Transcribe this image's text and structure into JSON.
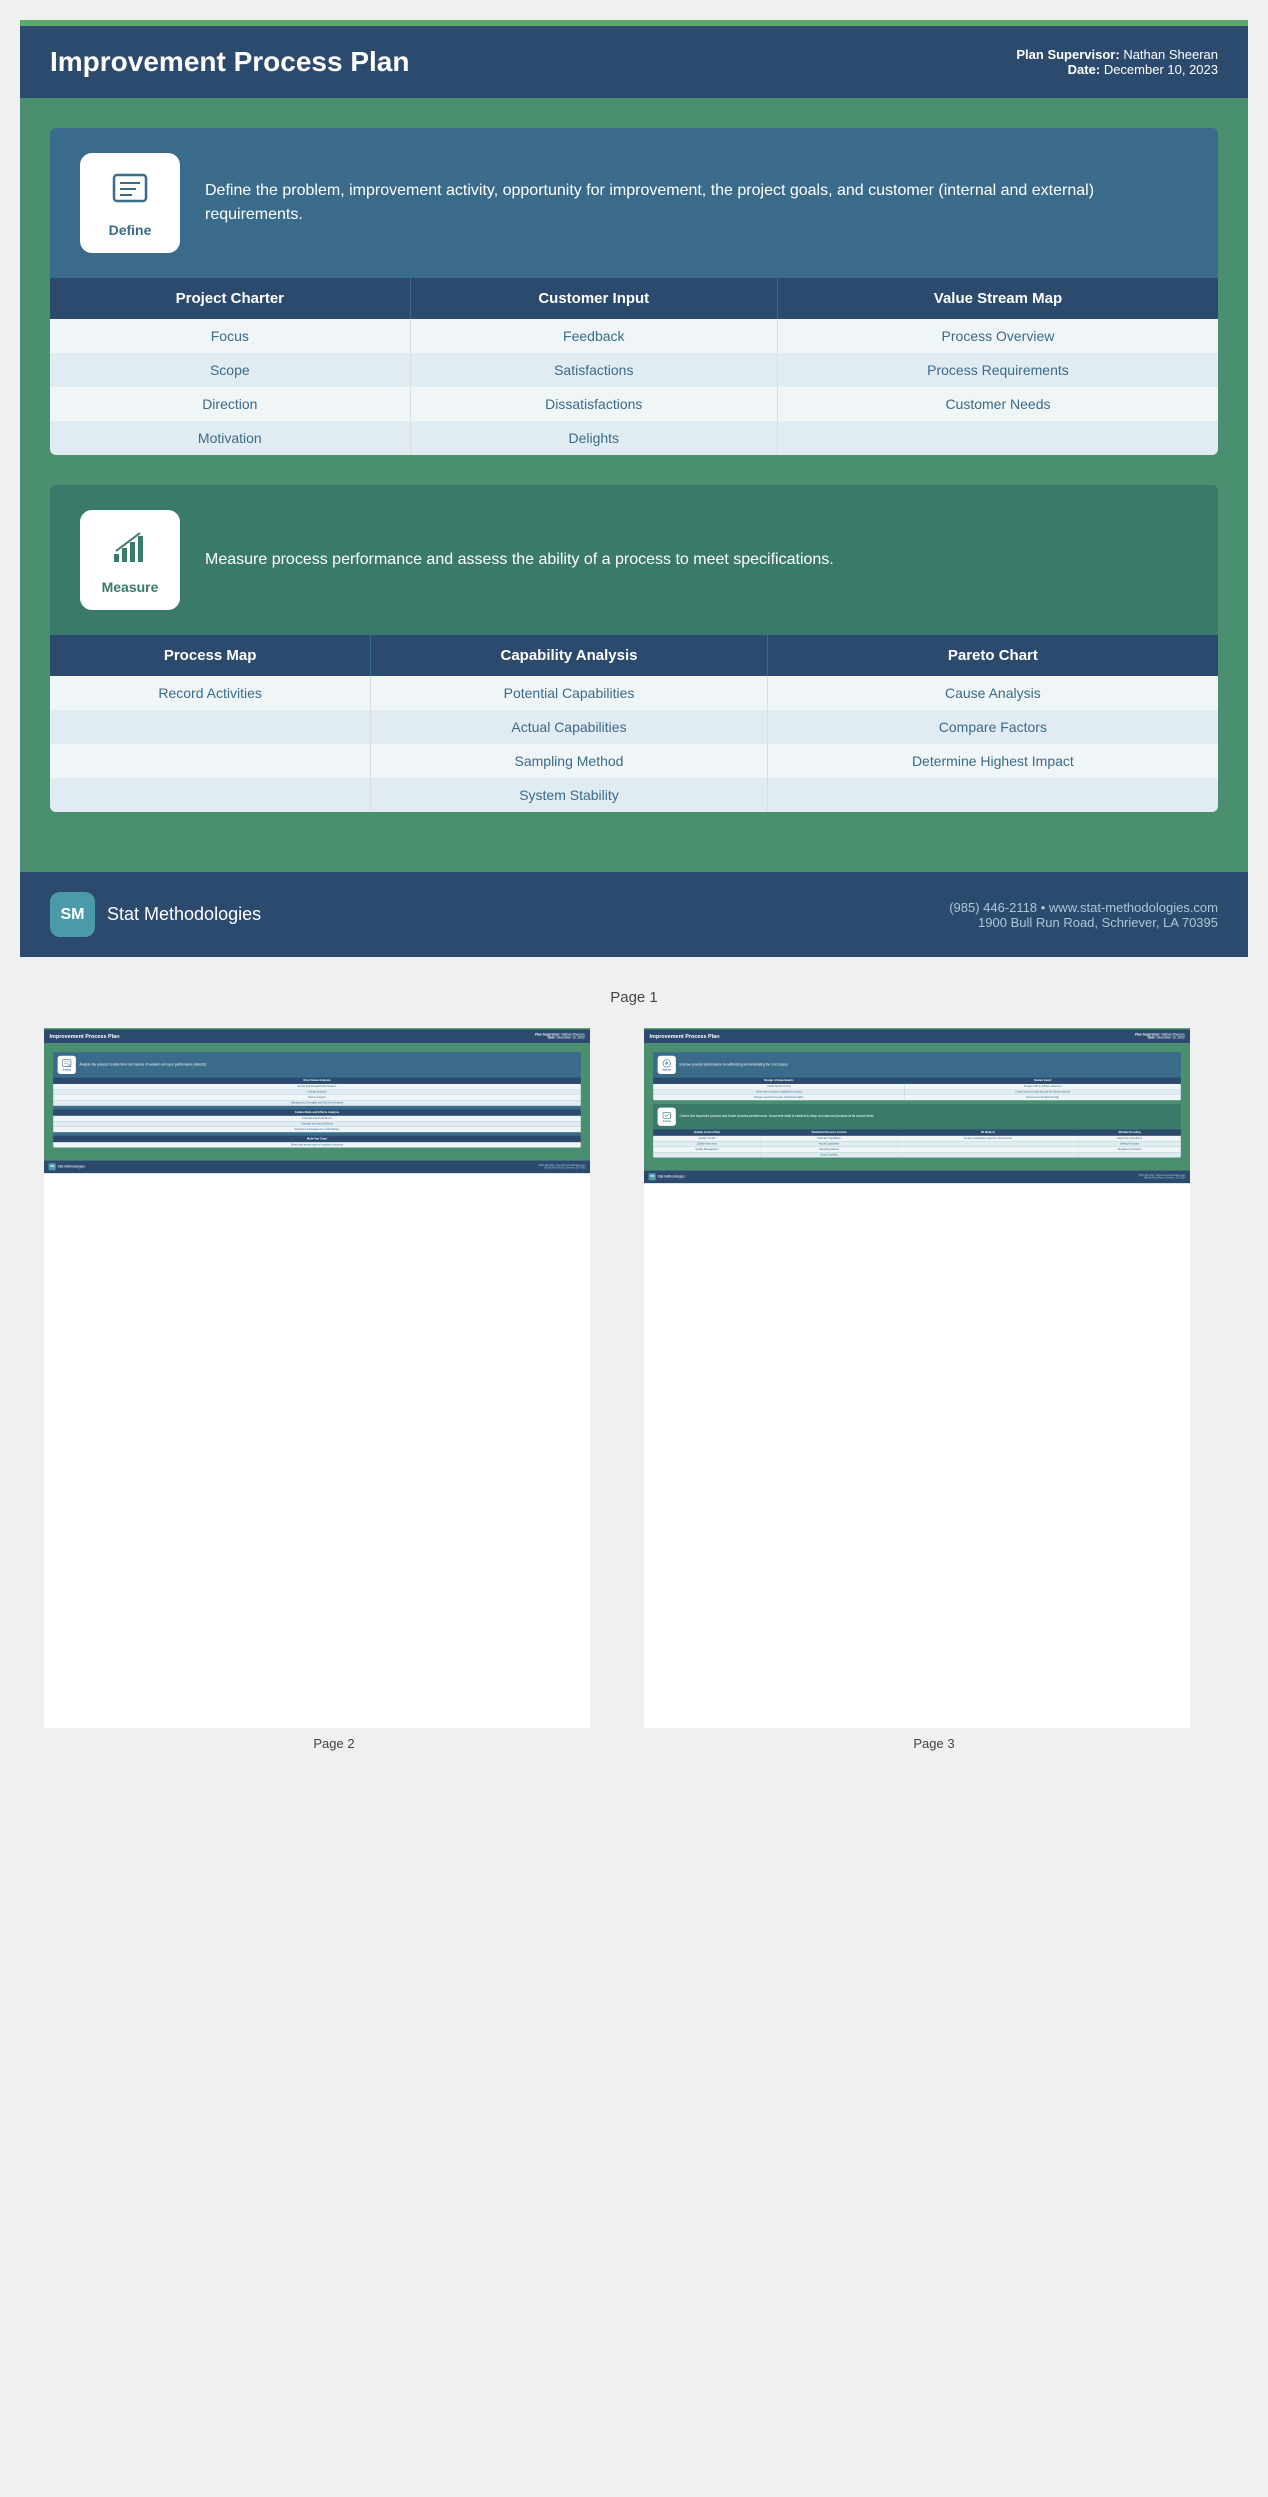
{
  "header": {
    "title": "Improvement Process Plan",
    "supervisor_label": "Plan Supervisor:",
    "supervisor_name": "Nathan Sheeran",
    "date_label": "Date:",
    "date_value": "December 10, 2023"
  },
  "define_section": {
    "icon_label": "Define",
    "description": "Define the problem, improvement activity, opportunity for improvement, the project goals, and customer (internal and external) requirements.",
    "columns": [
      {
        "header": "Project Charter",
        "items": [
          "Focus",
          "Scope",
          "Direction",
          "Motivation"
        ]
      },
      {
        "header": "Customer Input",
        "items": [
          "Feedback",
          "Satisfactions",
          "Dissatisfactions",
          "Delights"
        ]
      },
      {
        "header": "Value Stream Map",
        "items": [
          "Process Overview",
          "Process Requirements",
          "Customer Needs"
        ]
      }
    ]
  },
  "measure_section": {
    "icon_label": "Measure",
    "description": "Measure process performance and assess the ability of a process to meet specifications.",
    "columns": [
      {
        "header": "Process Map",
        "items": [
          "Record Activities"
        ]
      },
      {
        "header": "Capability Analysis",
        "items": [
          "Potential Capabilities",
          "Actual Capabilities",
          "Sampling Method",
          "System Stability"
        ]
      },
      {
        "header": "Pareto Chart",
        "items": [
          "Cause Analysis",
          "Compare Factors",
          "Determine Highest Impact"
        ]
      }
    ]
  },
  "footer": {
    "logo_text": "SM",
    "brand_name": "Stat Methodologies",
    "phone": "(985) 446-2118",
    "website": "www.stat-methodologies.com",
    "address": "1900 Bull Run Road, Schriever, LA 70395"
  },
  "pages": {
    "page1_label": "Page 1",
    "page2_label": "Page 2",
    "page3_label": "Page 3"
  },
  "page2": {
    "section": {
      "icon_label": "Analyze",
      "description": "Analyze the process to determine root causes of variation and poor performance (defects).",
      "tables": [
        {
          "header": "Root Cause Analysis",
          "items": [
            "Events and Causal Factor Analysis",
            "Change Analysis",
            "Barrier Analysis",
            "Management Oversight and Risk Tree Analysis"
          ]
        },
        {
          "header": "Failure Mode and Effects Analysis",
          "items": [
            "Potential and Actual Errors",
            "Potential and Actual Defects",
            "Determine Consequences of All Failures"
          ]
        },
        {
          "header": "Multi-Vari Chart",
          "items": [
            "Detect and assess types of variation in process"
          ]
        }
      ]
    }
  },
  "page3": {
    "improve_section": {
      "icon_label": "Improve",
      "description": "Improve process performance by addressing and eliminating the root causes.",
      "columns": [
        {
          "header": "Design of Experiments",
          "items": [
            "Isolate factors to test",
            "Determine resources available for testing",
            "Design experiment to give optimized insights"
          ]
        },
        {
          "header": "Kaizen Event",
          "items": [
            "Prepare with a problem statement",
            "Create teams to work through the Kaizen process",
            "Document and follow through"
          ]
        }
      ]
    },
    "control_section": {
      "icon_label": "Control",
      "description": "Control the improved process and future process performance. Document what is needed to keep an improved process at its current level.",
      "columns": [
        {
          "header": "Quality Control Plan",
          "items": [
            "Quality Control",
            "Quality Assurance",
            "Quality Management"
          ]
        },
        {
          "header": "Statistical Process Control",
          "items": [
            "Potential Capabilities",
            "Actual Capabilities",
            "Sampling Method",
            "System Stability"
          ]
        },
        {
          "header": "5S Method",
          "items": [
            "Create a workplace suited for visual control"
          ]
        },
        {
          "header": "Mistake Proofing",
          "items": [
            "Determine procedures",
            "Setting Functions",
            "Regulatory Functions"
          ]
        }
      ]
    }
  }
}
